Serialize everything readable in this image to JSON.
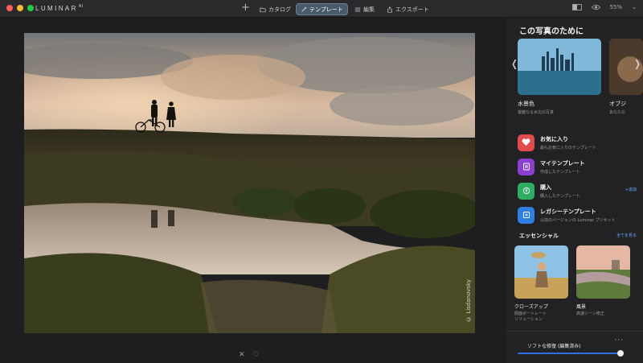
{
  "app": {
    "brand": "LUMINAR",
    "brand_suffix": "AI",
    "colors": {
      "accent": "#4a5a6a",
      "link": "#6fa8ff",
      "slider": "#2f6fe0"
    }
  },
  "toolbar": {
    "add_icon": "plus-icon",
    "tabs": [
      {
        "label": "カタログ",
        "icon": "folder-icon",
        "active": false
      },
      {
        "label": "テンプレート",
        "icon": "magic-wand-icon",
        "active": true
      },
      {
        "label": "編集",
        "icon": "sliders-icon",
        "active": false
      },
      {
        "label": "エクスポート",
        "icon": "export-icon",
        "active": false
      }
    ],
    "zoom": "55%"
  },
  "canvas": {
    "watermark": "© Lisdanovsky",
    "bottom_actions": [
      {
        "icon": "close-icon",
        "glyph": "✕"
      },
      {
        "icon": "heart-icon",
        "glyph": "♡"
      }
    ]
  },
  "panel": {
    "title": "この写真のために",
    "featured": [
      {
        "title": "水景色",
        "subtitle": "複雑なる水辺の写真"
      },
      {
        "title": "オブジ",
        "subtitle": "あなたの"
      }
    ],
    "categories": [
      {
        "name": "お気に入り",
        "subtitle": "最もお気に入りのテンプレート",
        "icon": "heart-icon",
        "color": "#e14b4b"
      },
      {
        "name": "マイテンプレート",
        "subtitle": "作成したテンプレート",
        "icon": "user-template-icon",
        "color": "#8a3fd1"
      },
      {
        "name": "購入",
        "subtitle": "購入したテンプレート",
        "icon": "purchase-icon",
        "color": "#2fae63",
        "link": "+追加"
      },
      {
        "name": "レガシーテンプレート",
        "subtitle": "以前のバージョンの Luminar プリセット",
        "icon": "legacy-icon",
        "color": "#2f7fe0"
      }
    ],
    "essentials": {
      "title": "エッセンシャル",
      "see_all": "全てを見る",
      "items": [
        {
          "name": "クローズアップ",
          "subtitle": "顔面ポートレート\nソリューション"
        },
        {
          "name": "風景",
          "subtitle": "高速シーン修正"
        }
      ]
    },
    "bottom": {
      "label": "ソフトな修復 (編集済み)",
      "more": "···",
      "amount": 0.95
    }
  }
}
